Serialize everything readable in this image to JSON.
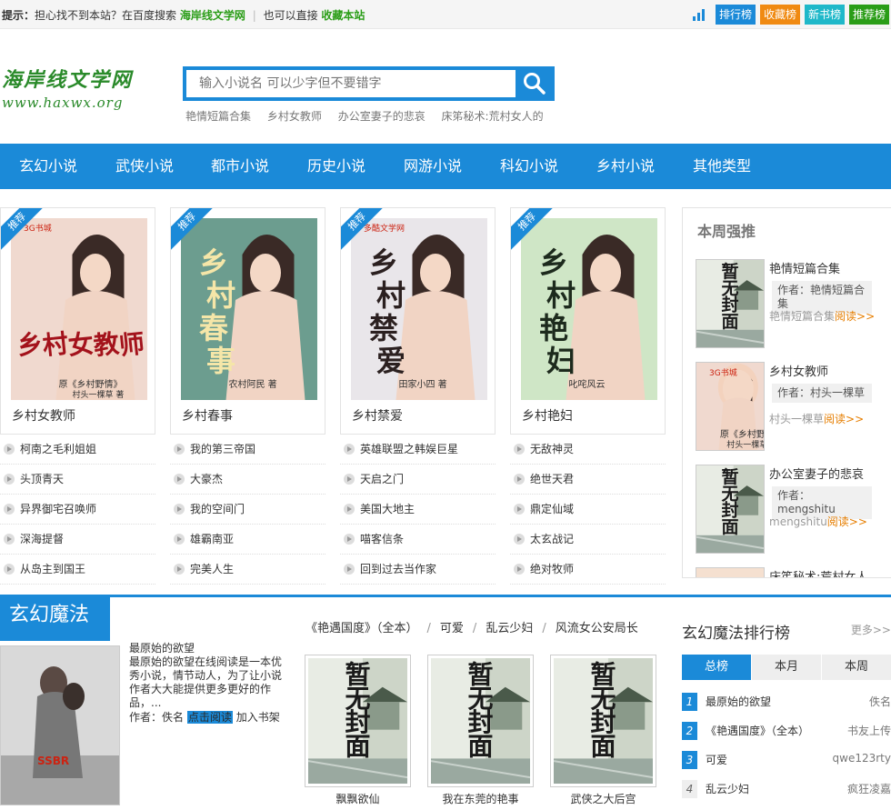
{
  "topbar": {
    "tip_label": "提示：",
    "tip_text1": "担心找不到本站？在百度搜索",
    "site_name": "海岸线文学网",
    "sep": "|",
    "tip_text2": "也可以直接",
    "bookmark": "收藏本站",
    "buttons": [
      {
        "label": "排行榜",
        "color": "#1b8ad8"
      },
      {
        "label": "收藏榜",
        "color": "#f08a12"
      },
      {
        "label": "新书榜",
        "color": "#1fb8c9"
      },
      {
        "label": "推荐榜",
        "color": "#2a9d17"
      }
    ]
  },
  "logo": {
    "cn": "海岸线文学网",
    "en": "www.haxwx.org"
  },
  "search": {
    "placeholder": "输入小说名 可以少字但不要错字"
  },
  "hotwords": [
    "艳情短篇合集",
    "乡村女教师",
    "办公室妻子的悲哀",
    "床笫秘术:荒村女人的"
  ],
  "nav": [
    "玄幻小说",
    "武侠小说",
    "都市小说",
    "历史小说",
    "网游小说",
    "科幻小说",
    "乡村小说",
    "其他类型"
  ],
  "featured": [
    {
      "title": "乡村女教师",
      "badge": "推荐",
      "cover_text": "乡村女教师",
      "cover_sub": "原《乡村野情》",
      "cover_author": "村头一棵草 著",
      "bg": "#f0d9cf",
      "ink": "#a3121b",
      "top_mark": "3G书城"
    },
    {
      "title": "乡村春事",
      "badge": "推荐",
      "cover_text": "乡村春事",
      "cover_sub": "农村阿民 著",
      "cover_author": "",
      "bg": "#6c9d8f",
      "ink": "#f5e6a8",
      "top_mark": ""
    },
    {
      "title": "乡村禁爱",
      "badge": "推荐",
      "cover_text": "乡村禁爱",
      "cover_sub": "田家小四 著",
      "cover_author": "",
      "bg": "#e9e6ea",
      "ink": "#2b2020",
      "top_mark": "多酷文学网"
    },
    {
      "title": "乡村艳妇",
      "badge": "推荐",
      "cover_text": "乡村艳妇",
      "cover_sub": "叱咤风云",
      "cover_author": "",
      "bg": "#cfe6c6",
      "ink": "#1d2a1d",
      "top_mark": ""
    }
  ],
  "lists": [
    [
      "柯南之毛利姐姐",
      "头顶青天",
      "异界御宅召唤师",
      "深海提督",
      "从岛主到国王"
    ],
    [
      "我的第三帝国",
      "大豪杰",
      "我的空间门",
      "雄霸南亚",
      "完美人生"
    ],
    [
      "英雄联盟之韩娱巨星",
      "天启之门",
      "美国大地主",
      "喵客信条",
      "回到过去当作家"
    ],
    [
      "无敌神灵",
      "绝世天君",
      "鼎定仙域",
      "太玄战记",
      "绝对牧师"
    ]
  ],
  "weekly": {
    "title": "本周强推",
    "author_prefix": "作者：",
    "read_more": "阅读>>",
    "items": [
      {
        "title": "艳情短篇合集",
        "author": "艳情短篇合集",
        "desc": "艳情短篇合集",
        "cover": "placeholder"
      },
      {
        "title": "乡村女教师",
        "author": "村头一棵草",
        "desc": "村头一棵草",
        "cover": "teacher"
      },
      {
        "title": "办公室妻子的悲哀",
        "author": "mengshitu",
        "desc": "mengshitu",
        "cover": "placeholder"
      },
      {
        "title": "床笫秘术:荒村女人",
        "author": "",
        "desc": "",
        "cover": "red"
      }
    ]
  },
  "section": {
    "title": "玄幻魔法",
    "feat_title": "最原始的欲望",
    "feat_desc": "最原始的欲望在线阅读是一本优秀小说，情节动人，为了让小说作者大大能提供更多更好的作品，...",
    "feat_author_label": "作者：",
    "feat_author": "佚名",
    "feat_read": "点击阅读",
    "feat_shelf": "加入书架",
    "feat_cover_mark": "SSBR",
    "links": [
      "《艳遇国度》（全本）",
      "可爱",
      "乱云少妇",
      "风流女公安局长"
    ],
    "link_sep": "/",
    "books": [
      "飘飘欲仙",
      "我在东莞的艳事",
      "武侠之大后宫"
    ],
    "placeholder_text": [
      "暂",
      "无",
      "封",
      "面"
    ]
  },
  "ranking": {
    "title": "玄幻魔法排行榜",
    "more": "更多>>",
    "tabs": [
      "总榜",
      "本月",
      "本周"
    ],
    "items": [
      {
        "rank": "1",
        "name": "最原始的欲望",
        "author": "佚名"
      },
      {
        "rank": "2",
        "name": "《艳遇国度》（全本）",
        "author": "书友上传"
      },
      {
        "rank": "3",
        "name": "可爱",
        "author": "qwe123rty"
      },
      {
        "rank": "4",
        "name": "乱云少妇",
        "author": "疯狂凌嘉"
      }
    ]
  }
}
